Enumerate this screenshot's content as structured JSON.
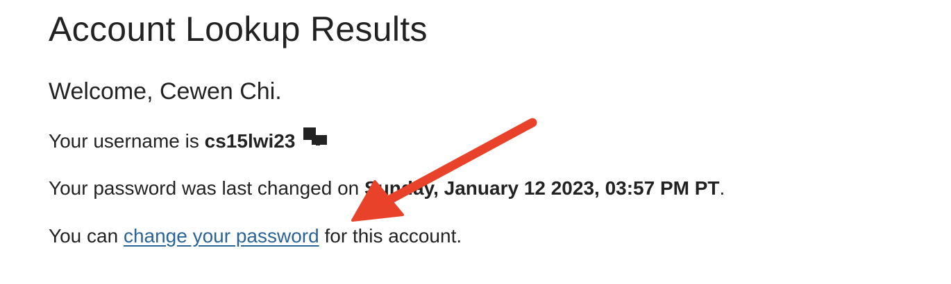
{
  "page": {
    "title": "Account Lookup Results",
    "welcome": "Welcome, Cewen Chi."
  },
  "username": {
    "prefix": "Your username is ",
    "value": "cs15lwi23",
    "copy_icon": "copy-icon"
  },
  "password": {
    "prefix": "Your password was last changed on ",
    "date": "Sunday, January 12 2023, 03:57 PM PT",
    "suffix": "."
  },
  "change": {
    "prefix": "You can ",
    "link_label": "change your password",
    "suffix": " for this account."
  },
  "annotation": {
    "arrow_color": "#e8432a"
  },
  "colors": {
    "link": "#2a6496",
    "text": "#222222"
  }
}
